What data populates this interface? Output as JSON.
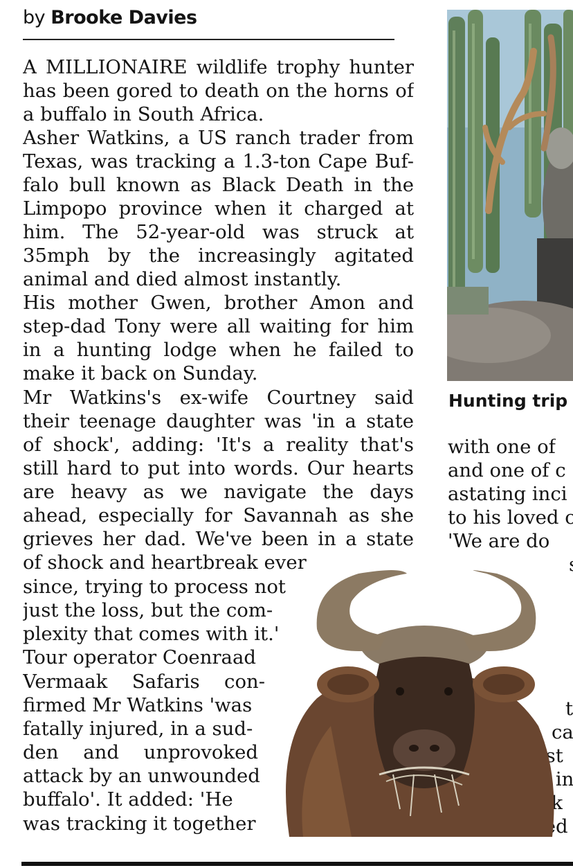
{
  "byline": {
    "prefix": "by",
    "author": "Brooke Davies"
  },
  "main_lines": [
    "A MILLIONAIRE wildlife trophy hunter",
    "has been gored to death on the horns of",
    "a buffalo in South Africa.",
    "  Asher Watkins, a US ranch trader from",
    "Texas, was tracking a 1.3-ton Cape Buf-",
    "falo bull known as Black Death in the",
    "Limpopo province when it charged at",
    "him. The 52-year-old was struck at",
    "35mph by the increasingly agitated",
    "animal and died almost instantly.",
    "  His mother Gwen, brother Amon and",
    "step-dad Tony were all waiting for him",
    "in a hunting lodge when he failed to",
    "make it back on Sunday.",
    "  Mr Watkins's ex-wife Courtney said",
    "their teenage daughter was 'in a state",
    "of shock', adding: 'It's a reality that's",
    "still hard to put into words. Our hearts",
    "are heavy as we navigate the days",
    "ahead, especially for Savannah as she",
    "grieves her dad. We've been in a state",
    "of shock and heartbreak ever",
    "since, trying to process not",
    "just the loss, but the com-",
    "plexity that comes with it.'",
    "  Tour operator Coenraad",
    "Vermaak Safaris con-",
    "firmed Mr Watkins 'was",
    "fatally injured, in a sud-",
    "den and unprovoked",
    "attack by an unwounded",
    "buffalo'. It added: 'He",
    "was tracking it together"
  ],
  "caption": "Hunting trip",
  "right_lines": [
    "with one of",
    "and one of c",
    "astating inci",
    "to his loved c",
    "  'We are do",
    "s",
    "t",
    "ca",
    "most",
    "sue in",
    "are k",
    "voked"
  ]
}
